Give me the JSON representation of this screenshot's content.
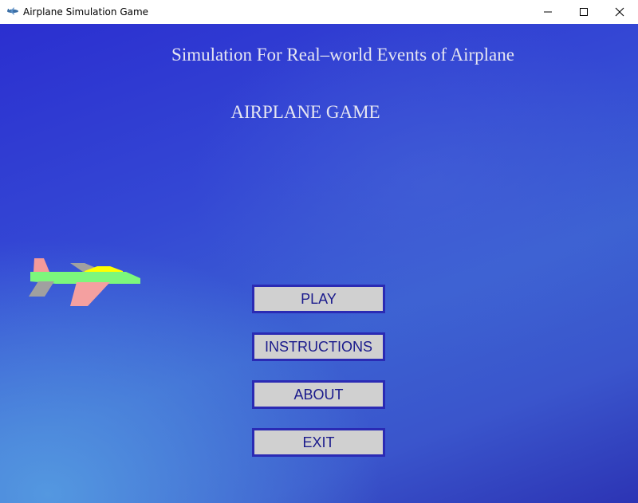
{
  "window": {
    "title": "Airplane Simulation Game",
    "icon": "airplane-app-icon",
    "controls": [
      "minimize-icon",
      "maximize-icon",
      "close-icon"
    ]
  },
  "screen": {
    "subtitle": "Simulation For Real–world Events of Airplane",
    "title": "AIRPLANE GAME",
    "background_colors": [
      "#2b2fd0",
      "#3c62d2",
      "#5a9be0",
      "#2c34b4"
    ]
  },
  "airplane": {
    "icon": "airplane-sprite",
    "colors": {
      "fuselage": "#7cf77c",
      "cockpit": "#ffff00",
      "wing": "#f4a0a0",
      "tail_fin": "#f49a9a",
      "stabilizer": "#a0a0a0"
    }
  },
  "menu": {
    "play": "PLAY",
    "instructions": "INSTRUCTIONS",
    "about": "ABOUT",
    "exit": "EXIT"
  },
  "colors": {
    "button_fill": "#d0d0d0",
    "button_border": "#2a2ab4",
    "button_text": "#1a1a8c",
    "title_text": "#e6e6f2"
  }
}
